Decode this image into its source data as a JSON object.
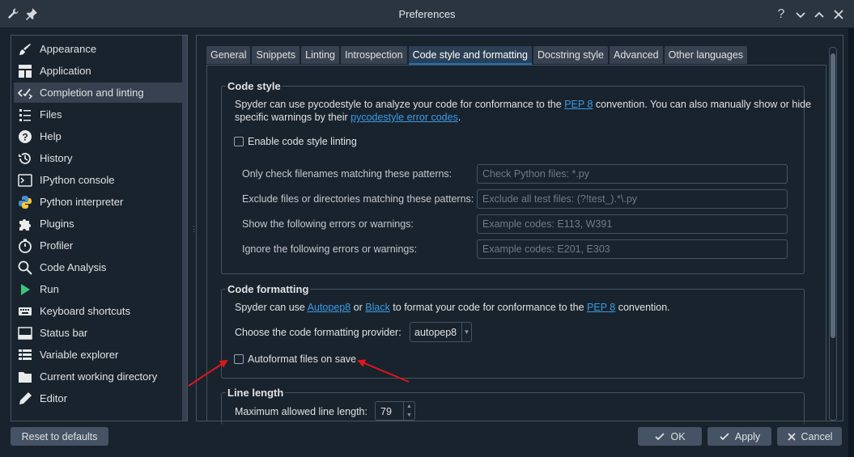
{
  "window": {
    "title": "Preferences",
    "icons": [
      "wrench-icon",
      "pin-icon"
    ],
    "controls": [
      "help-icon",
      "minimize-icon",
      "maximize-icon",
      "close-icon"
    ]
  },
  "sidebar": {
    "items": [
      {
        "label": "Appearance",
        "icon": "paintbrush-icon"
      },
      {
        "label": "Application",
        "icon": "application-icon"
      },
      {
        "label": "Completion and linting",
        "icon": "check-code-icon",
        "selected": true
      },
      {
        "label": "Files",
        "icon": "files-icon"
      },
      {
        "label": "Help",
        "icon": "help-circle-icon"
      },
      {
        "label": "History",
        "icon": "history-icon"
      },
      {
        "label": "IPython console",
        "icon": "console-icon"
      },
      {
        "label": "Python interpreter",
        "icon": "python-icon"
      },
      {
        "label": "Plugins",
        "icon": "puzzle-icon"
      },
      {
        "label": "Profiler",
        "icon": "stopwatch-icon"
      },
      {
        "label": "Code Analysis",
        "icon": "magnifier-code-icon"
      },
      {
        "label": "Run",
        "icon": "play-icon"
      },
      {
        "label": "Keyboard shortcuts",
        "icon": "keyboard-icon"
      },
      {
        "label": "Status bar",
        "icon": "statusbar-icon"
      },
      {
        "label": "Variable explorer",
        "icon": "table-icon"
      },
      {
        "label": "Current working directory",
        "icon": "folder-icon"
      },
      {
        "label": "Editor",
        "icon": "pencil-icon"
      }
    ]
  },
  "tabs": [
    {
      "label": "General"
    },
    {
      "label": "Snippets"
    },
    {
      "label": "Linting"
    },
    {
      "label": "Introspection"
    },
    {
      "label": "Code style and formatting",
      "active": true
    },
    {
      "label": "Docstring style"
    },
    {
      "label": "Advanced"
    },
    {
      "label": "Other languages"
    }
  ],
  "code_style": {
    "title": "Code style",
    "desc_1": "Spyder can use pycodestyle to analyze your code for conformance to the ",
    "pep8_link": "PEP 8",
    "desc_2": " convention. You can also manually show or hide",
    "desc_3": "specific warnings by their ",
    "error_codes_link": "pycodestyle error codes",
    "desc_4": ".",
    "enable_label": "Enable code style linting",
    "fields": [
      {
        "label": "Only check filenames matching these patterns:",
        "placeholder": "Check Python files: *.py"
      },
      {
        "label": "Exclude files or directories matching these patterns:",
        "placeholder": "Exclude all test files: (?!test_).*\\.py"
      },
      {
        "label": "Show the following errors or warnings:",
        "placeholder": "Example codes: E113, W391"
      },
      {
        "label": "Ignore the following errors or warnings:",
        "placeholder": "Example codes: E201, E303"
      }
    ]
  },
  "code_formatting": {
    "title": "Code formatting",
    "desc_1": "Spyder can use ",
    "autopep8_link": "Autopep8",
    "desc_or": " or ",
    "black_link": "Black",
    "desc_2": " to format your code for conformance to the ",
    "pep8_link": "PEP 8",
    "desc_3": " convention.",
    "provider_label": "Choose the code formatting provider:",
    "provider_value": "autopep8",
    "autoformat_label": "Autoformat files on save"
  },
  "line_length": {
    "title": "Line length",
    "max_label": "Maximum allowed line length:",
    "max_value": "79"
  },
  "footer": {
    "reset": "Reset to defaults",
    "ok": "OK",
    "apply": "Apply",
    "cancel": "Cancel"
  },
  "colors": {
    "background": "#19232d",
    "accent": "#1a72bb",
    "link": "#3a9be6",
    "annotation_arrow": "#e0161d"
  }
}
